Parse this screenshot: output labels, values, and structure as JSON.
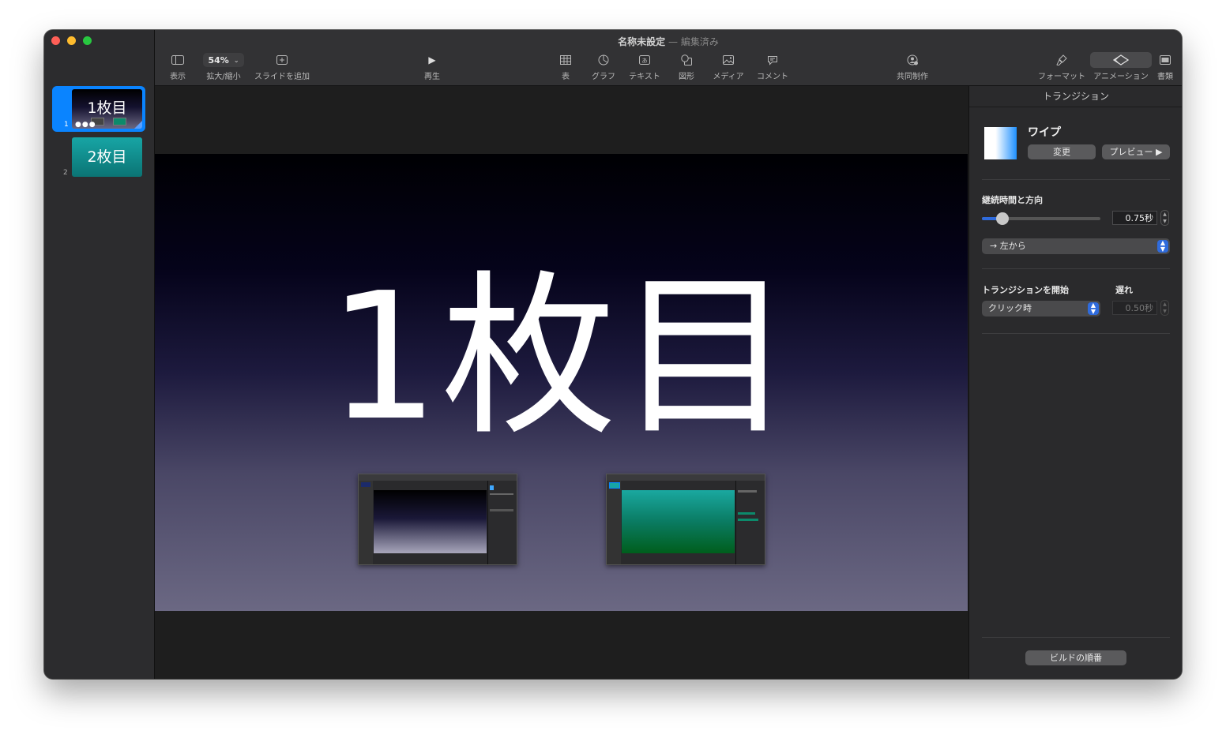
{
  "window": {
    "title": "名称未設定",
    "title_separator": "—",
    "title_status": "編集済み"
  },
  "toolbar": {
    "view_label": "表示",
    "zoom_value": "54%",
    "zoom_label": "拡大/縮小",
    "add_slide_label": "スライドを追加",
    "play_label": "再生",
    "table_label": "表",
    "chart_label": "グラフ",
    "text_label": "テキスト",
    "shape_label": "図形",
    "media_label": "メディア",
    "comment_label": "コメント",
    "collaborate_label": "共同制作",
    "format_label": "フォーマット",
    "animate_label": "アニメーション",
    "document_label": "書類"
  },
  "navigator": {
    "slides": [
      {
        "number": "1",
        "title": "1枚目"
      },
      {
        "number": "2",
        "title": "2枚目"
      }
    ]
  },
  "slide": {
    "title": "1枚目"
  },
  "inspector": {
    "header": "トランジション",
    "effect_name": "ワイプ",
    "change_button": "変更",
    "preview_button": "プレビュー ▶",
    "duration_label": "継続時間と方向",
    "duration_value": "0.75秒",
    "duration_slider_fraction": 0.17,
    "direction_value": "→ 左から",
    "start_label": "トランジションを開始",
    "start_value": "クリック時",
    "delay_label": "遅れ",
    "delay_value": "0.50秒",
    "build_order_button": "ビルドの順番"
  },
  "colors": {
    "accent": "#0a84ff",
    "close": "#ff5f57",
    "minimize": "#febc2e",
    "zoom": "#28c840",
    "slide2_bg": "#138f8f"
  }
}
